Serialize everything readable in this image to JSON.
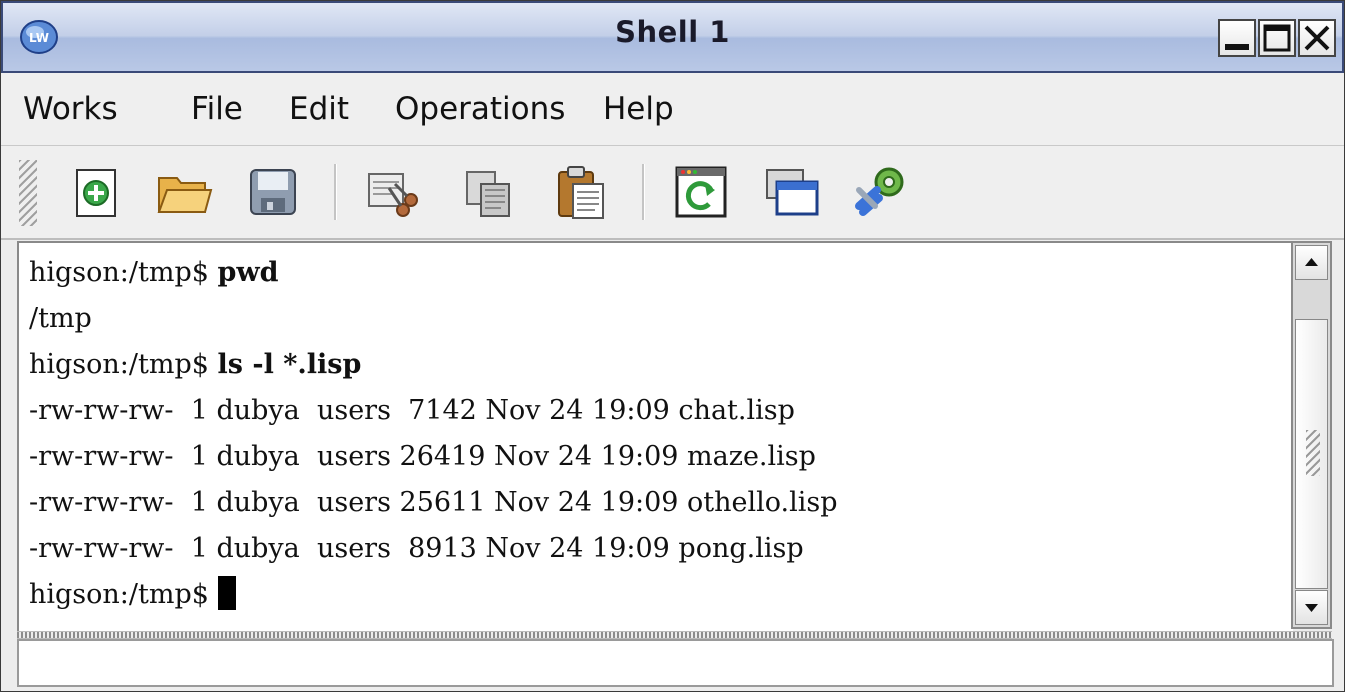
{
  "window": {
    "title": "Shell 1",
    "app_icon_label": "LW"
  },
  "menu": {
    "items": [
      {
        "label": "Works"
      },
      {
        "label": "File"
      },
      {
        "label": "Edit"
      },
      {
        "label": "Operations"
      },
      {
        "label": "Help"
      }
    ]
  },
  "toolbar": {
    "buttons": [
      {
        "icon": "new-file-icon"
      },
      {
        "icon": "open-folder-icon"
      },
      {
        "icon": "save-disk-icon"
      },
      {
        "icon": "cut-scissors-icon"
      },
      {
        "icon": "copy-icon"
      },
      {
        "icon": "paste-clipboard-icon"
      },
      {
        "icon": "refresh-icon"
      },
      {
        "icon": "window-icon"
      },
      {
        "icon": "tools-icon"
      }
    ]
  },
  "terminal": {
    "lines": [
      {
        "prompt": "higson:/tmp$ ",
        "command": "pwd",
        "text": ""
      },
      {
        "prompt": "",
        "command": "",
        "text": "/tmp"
      },
      {
        "prompt": "higson:/tmp$ ",
        "command": "ls -l *.lisp",
        "text": ""
      },
      {
        "prompt": "",
        "command": "",
        "text": "-rw-rw-rw-  1 dubya  users  7142 Nov 24 19:09 chat.lisp"
      },
      {
        "prompt": "",
        "command": "",
        "text": "-rw-rw-rw-  1 dubya  users 26419 Nov 24 19:09 maze.lisp"
      },
      {
        "prompt": "",
        "command": "",
        "text": "-rw-rw-rw-  1 dubya  users 25611 Nov 24 19:09 othello.lisp"
      },
      {
        "prompt": "",
        "command": "",
        "text": "-rw-rw-rw-  1 dubya  users  8913 Nov 24 19:09 pong.lisp"
      },
      {
        "prompt": "higson:/tmp$ ",
        "command": "",
        "text": ""
      }
    ]
  },
  "echo_area": {
    "text": ""
  }
}
